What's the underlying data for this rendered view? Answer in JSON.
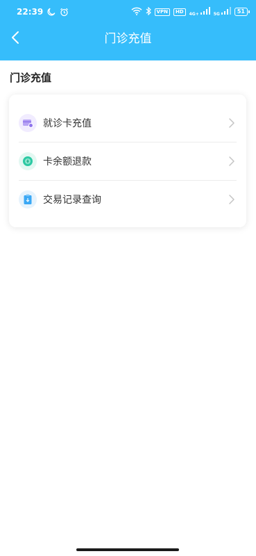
{
  "status_bar": {
    "time": "22:39",
    "icons": [
      "moon-icon",
      "alarm-icon",
      "wifi-icon",
      "bluetooth-icon",
      "vpn-badge",
      "hd-badge",
      "signal-icon",
      "signal-icon"
    ],
    "vpn": "VPN",
    "hd": "HD",
    "net1": "4G+",
    "net2": "5G",
    "battery": "51"
  },
  "nav": {
    "title": "门诊充值",
    "back_icon": "chevron-left-icon"
  },
  "section": {
    "title": "门诊充值"
  },
  "menu": {
    "items": [
      {
        "label": "就诊卡充值",
        "icon": "card-recharge-icon",
        "icon_color": "#9b7bf0",
        "icon_bg": "#f1ecff"
      },
      {
        "label": "卡余额退款",
        "icon": "refund-coin-icon",
        "icon_color": "#2cc9a3",
        "icon_bg": "#e3f8f2"
      },
      {
        "label": "交易记录查询",
        "icon": "record-query-icon",
        "icon_color": "#3aa8f5",
        "icon_bg": "#e6f3fd"
      }
    ]
  },
  "colors": {
    "header": "#36bdfb",
    "text": "#333333"
  }
}
